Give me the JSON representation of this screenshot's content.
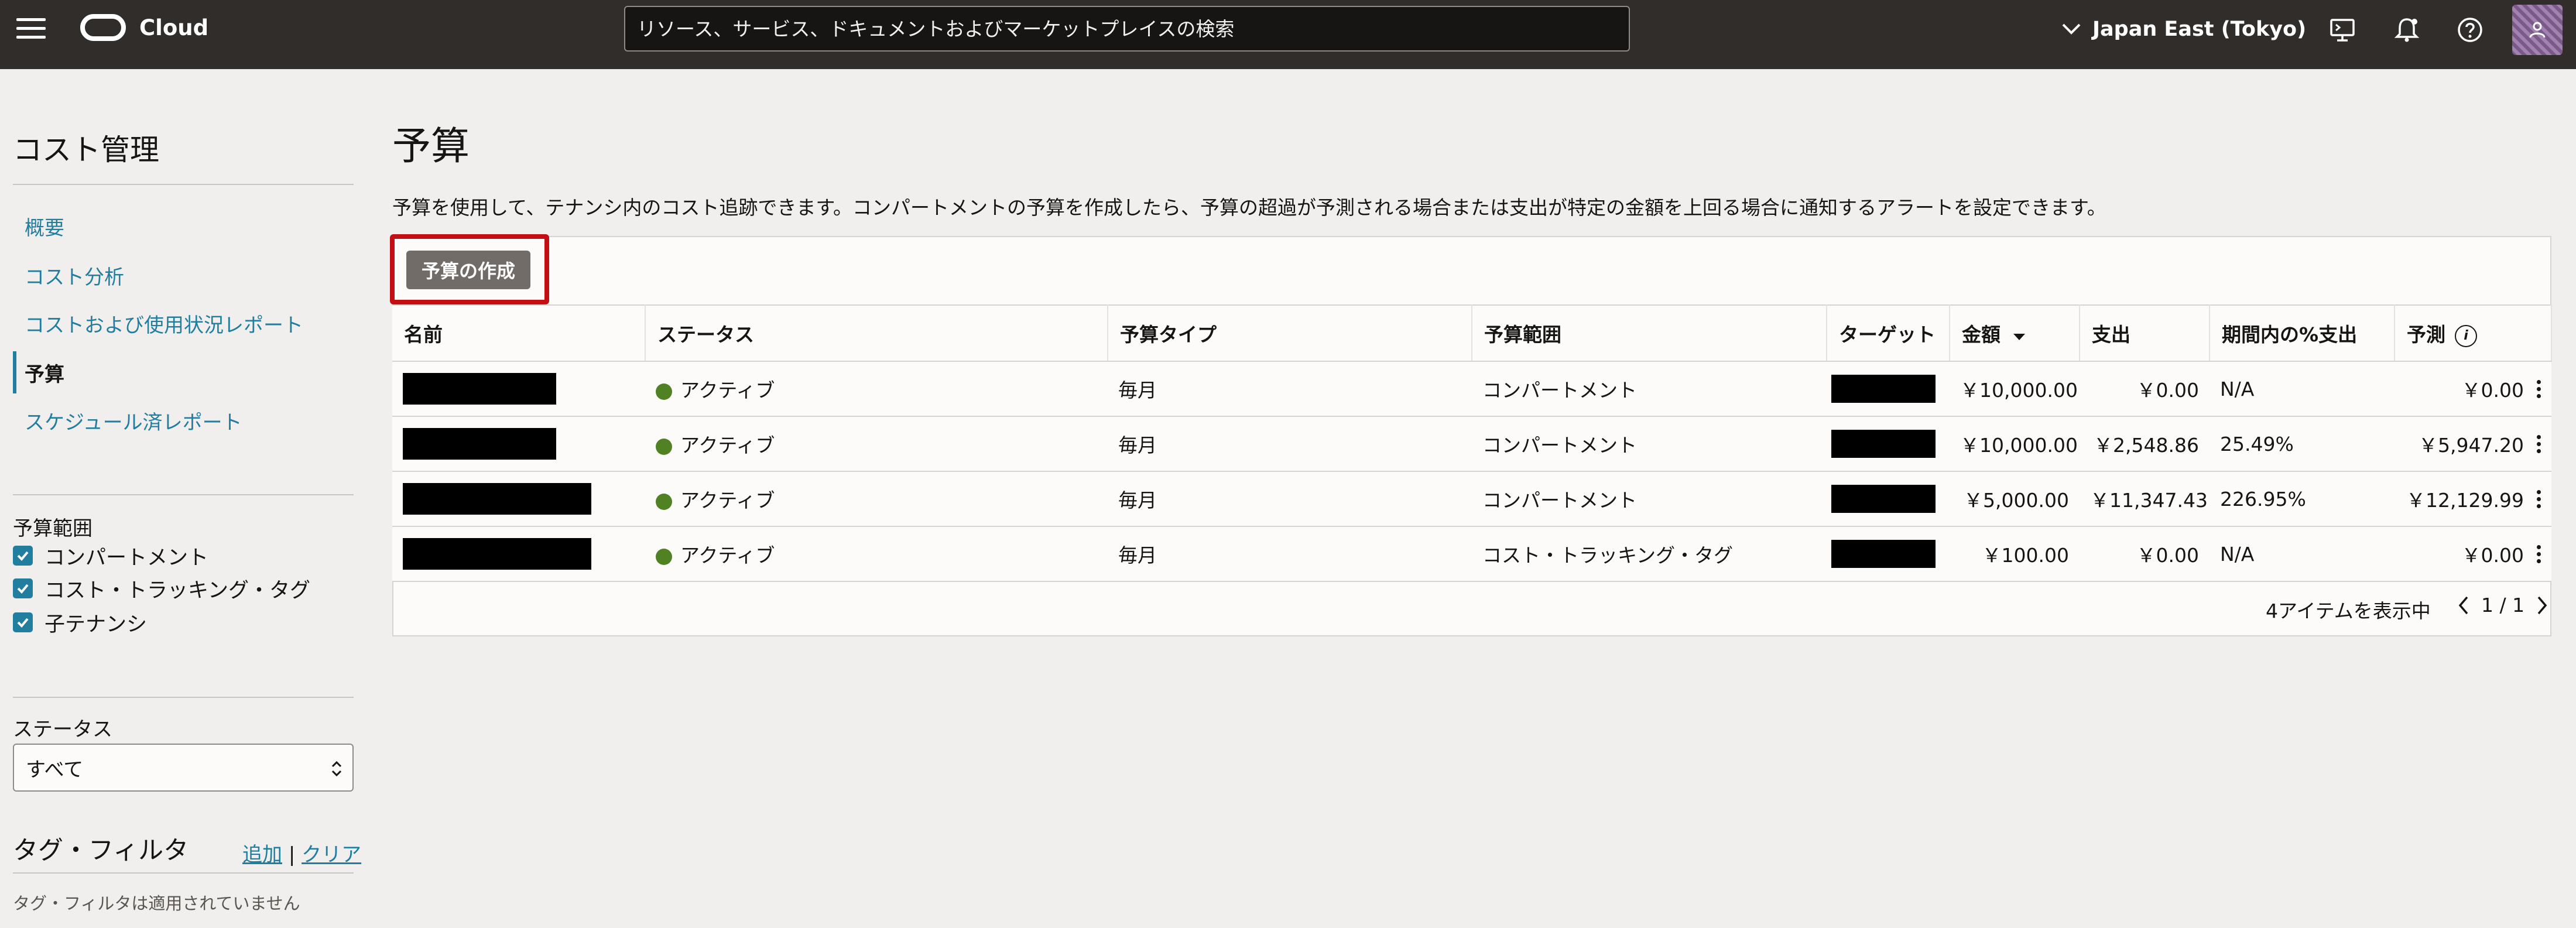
{
  "header": {
    "brand": "Cloud",
    "search_placeholder": "リソース、サービス、ドキュメントおよびマーケットプレイスの検索",
    "region": "Japan East (Tokyo)",
    "icons": [
      "menu-icon",
      "oracle-logo",
      "chevron-down-icon",
      "cloud-shell-icon",
      "bell-icon",
      "help-icon",
      "user-icon"
    ]
  },
  "sidebar": {
    "title": "コスト管理",
    "nav": [
      {
        "label": "概要",
        "active": false
      },
      {
        "label": "コスト分析",
        "active": false
      },
      {
        "label": "コストおよび使用状況レポート",
        "active": false
      },
      {
        "label": "予算",
        "active": true
      },
      {
        "label": "スケジュール済レポート",
        "active": false
      }
    ],
    "scope_filter": {
      "heading": "予算範囲",
      "options": [
        {
          "label": "コンパートメント",
          "checked": true
        },
        {
          "label": "コスト・トラッキング・タグ",
          "checked": true
        },
        {
          "label": "子テナンシ",
          "checked": true
        }
      ]
    },
    "status_filter": {
      "heading": "ステータス",
      "selected": "すべて"
    },
    "tag_filter": {
      "title": "タグ・フィルタ",
      "add": "追加",
      "separator": "|",
      "clear": "クリア",
      "empty_note": "タグ・フィルタは適用されていません"
    }
  },
  "main": {
    "title": "予算",
    "description": "予算を使用して、テナンシ内のコスト追跡できます。コンパートメントの予算を作成したら、予算の超過が予測される場合または支出が特定の金額を上回る場合に通知するアラートを設定できます。",
    "create_button": "予算の作成",
    "highlight_color": "#c30f13",
    "columns": [
      "名前",
      "ステータス",
      "予算タイプ",
      "予算範囲",
      "ターゲット",
      "金額",
      "支出",
      "期間内の%支出",
      "予測"
    ],
    "rows": [
      {
        "name": "",
        "status": "アクティブ",
        "type": "毎月",
        "scope": "コンパートメント",
        "target": "",
        "amount": "￥10,000.00",
        "spent": "￥0.00",
        "pct": "N/A",
        "forecast": "￥0.00"
      },
      {
        "name": "",
        "status": "アクティブ",
        "type": "毎月",
        "scope": "コンパートメント",
        "target": "",
        "amount": "￥10,000.00",
        "spent": "￥2,548.86",
        "pct": "25.49%",
        "forecast": "￥5,947.20"
      },
      {
        "name": "",
        "status": "アクティブ",
        "type": "毎月",
        "scope": "コンパートメント",
        "target": "",
        "amount": "￥5,000.00",
        "spent": "￥11,347.43",
        "pct": "226.95%",
        "forecast": "￥12,129.99"
      },
      {
        "name": "",
        "status": "アクティブ",
        "type": "毎月",
        "scope": "コスト・トラッキング・タグ",
        "target": "",
        "amount": "￥100.00",
        "spent": "￥0.00",
        "pct": "N/A",
        "forecast": "￥0.00"
      }
    ],
    "footer": {
      "count": "4アイテムを表示中",
      "page": "1 / 1"
    }
  }
}
